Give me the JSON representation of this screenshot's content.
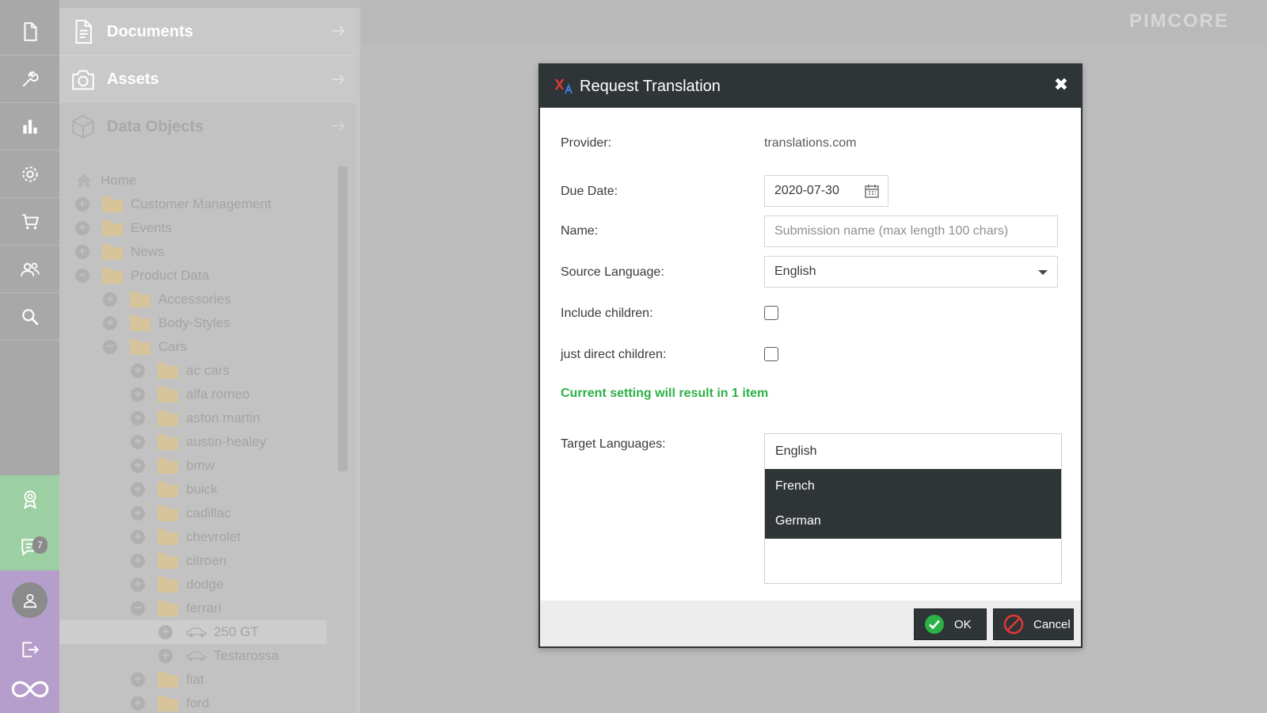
{
  "sidebar_rail": {
    "items": [
      {
        "name": "documents-icon"
      },
      {
        "name": "tools-icon"
      },
      {
        "name": "chart-icon"
      },
      {
        "name": "gear-icon"
      },
      {
        "name": "cart-icon"
      },
      {
        "name": "users-icon"
      },
      {
        "name": "search-icon"
      }
    ],
    "notification_count": "7"
  },
  "tree_panel": {
    "sections": [
      {
        "label": "Documents"
      },
      {
        "label": "Assets"
      },
      {
        "label": "Data Objects"
      }
    ],
    "tree": [
      {
        "label": "Home",
        "depth": 0,
        "type": "home"
      },
      {
        "label": "Customer Management",
        "depth": 0,
        "type": "folder",
        "state": "plus"
      },
      {
        "label": "Events",
        "depth": 0,
        "type": "folder",
        "state": "plus"
      },
      {
        "label": "News",
        "depth": 0,
        "type": "folder",
        "state": "plus"
      },
      {
        "label": "Product Data",
        "depth": 0,
        "type": "folder",
        "state": "minus"
      },
      {
        "label": "Accessories",
        "depth": 1,
        "type": "folder",
        "state": "plus"
      },
      {
        "label": "Body-Styles",
        "depth": 1,
        "type": "folder",
        "state": "plus"
      },
      {
        "label": "Cars",
        "depth": 1,
        "type": "folder",
        "state": "minus"
      },
      {
        "label": "ac cars",
        "depth": 2,
        "type": "folder",
        "state": "plus"
      },
      {
        "label": "alfa romeo",
        "depth": 2,
        "type": "folder",
        "state": "plus"
      },
      {
        "label": "aston martin",
        "depth": 2,
        "type": "folder",
        "state": "plus"
      },
      {
        "label": "austin-healey",
        "depth": 2,
        "type": "folder",
        "state": "plus"
      },
      {
        "label": "bmw",
        "depth": 2,
        "type": "folder",
        "state": "plus"
      },
      {
        "label": "buick",
        "depth": 2,
        "type": "folder",
        "state": "plus"
      },
      {
        "label": "cadillac",
        "depth": 2,
        "type": "folder",
        "state": "plus"
      },
      {
        "label": "chevrolet",
        "depth": 2,
        "type": "folder",
        "state": "plus"
      },
      {
        "label": "citroen",
        "depth": 2,
        "type": "folder",
        "state": "plus"
      },
      {
        "label": "dodge",
        "depth": 2,
        "type": "folder",
        "state": "plus"
      },
      {
        "label": "ferrari",
        "depth": 2,
        "type": "folder",
        "state": "minus"
      },
      {
        "label": "250 GT",
        "depth": 3,
        "type": "car",
        "state": "plus",
        "selected": true
      },
      {
        "label": "Testarossa",
        "depth": 3,
        "type": "car",
        "state": "plus"
      },
      {
        "label": "fiat",
        "depth": 2,
        "type": "folder",
        "state": "plus"
      },
      {
        "label": "ford",
        "depth": 2,
        "type": "folder",
        "state": "plus"
      }
    ]
  },
  "header": {
    "logo_text": "PIMCORE"
  },
  "dialog": {
    "title": "Request Translation",
    "close_label": "✖",
    "fields": {
      "provider_label": "Provider:",
      "provider_value": "translations.com",
      "due_date_label": "Due Date:",
      "due_date_value": "2020-07-30",
      "name_label": "Name:",
      "name_placeholder": "Submission name (max length 100 chars)",
      "source_language_label": "Source Language:",
      "source_language_value": "English",
      "include_children_label": "Include children:",
      "include_children_checked": false,
      "direct_children_label": "just direct children:",
      "direct_children_checked": false,
      "info_text": "Current setting will result in 1 item",
      "target_languages_label": "Target Languages:",
      "target_languages": [
        {
          "label": "English",
          "selected": false
        },
        {
          "label": "French",
          "selected": true
        },
        {
          "label": "German",
          "selected": true
        }
      ]
    },
    "buttons": {
      "ok_label": "OK",
      "cancel_label": "Cancel"
    }
  },
  "colors": {
    "dialog_header": "#2f3437",
    "success_text": "#2cb146",
    "rail_green": "#9ccfa1",
    "rail_purple": "#b59ecb"
  }
}
